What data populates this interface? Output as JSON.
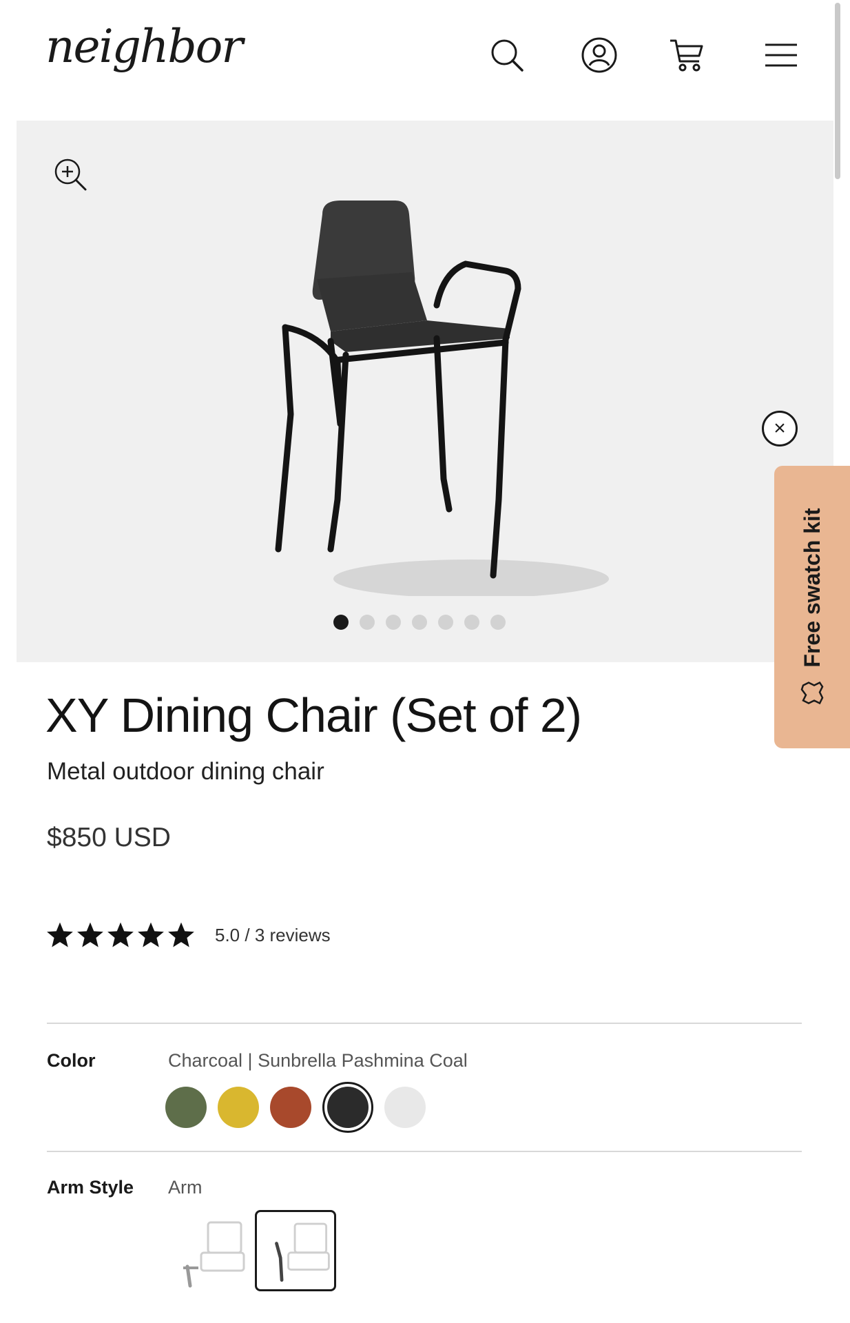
{
  "header": {
    "logo_text": "neighbor",
    "icons": [
      "search-icon",
      "account-icon",
      "cart-icon",
      "menu-icon"
    ]
  },
  "gallery": {
    "image_count": 7,
    "active_index": 0,
    "zoom_icon": "zoom-in-icon"
  },
  "swatch_kit": {
    "label": "Free swatch kit",
    "close_icon": "close-icon",
    "tab_color": "#e9b692"
  },
  "product": {
    "title": "XY Dining Chair (Set of 2)",
    "subtitle": "Metal outdoor dining chair",
    "price": "$850 USD",
    "rating": {
      "stars": 5,
      "text": "5.0 / 3 reviews"
    }
  },
  "options": {
    "color": {
      "label": "Color",
      "value": "Charcoal | Sunbrella Pashmina Coal",
      "swatches": [
        {
          "hex": "#5e6e4a",
          "selected": false
        },
        {
          "hex": "#d9b72f",
          "selected": false
        },
        {
          "hex": "#a8492c",
          "selected": false
        },
        {
          "hex": "#2b2b2b",
          "selected": true
        },
        {
          "hex": "#e8e8e8",
          "selected": false
        }
      ]
    },
    "arm_style": {
      "label": "Arm Style",
      "value": "Arm",
      "choices": [
        {
          "icon": "armless-chair-icon",
          "selected": false
        },
        {
          "icon": "arm-chair-icon",
          "selected": true
        }
      ]
    }
  }
}
